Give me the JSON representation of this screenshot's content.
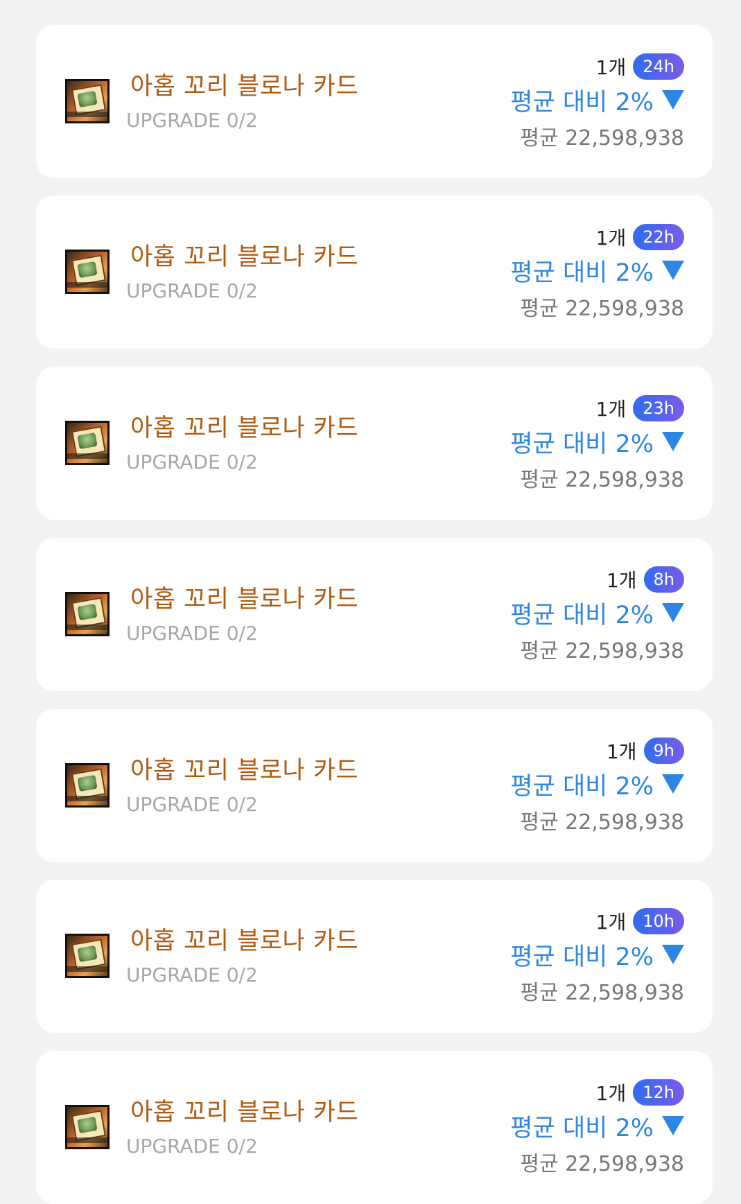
{
  "items": [
    {
      "name": "아홉 꼬리 블로나 카드",
      "upgrade": "UPGRADE 0/2",
      "quantity": "1개",
      "hours": "24h",
      "compare": "평균 대비 2%",
      "average": "평균 22,598,938"
    },
    {
      "name": "아홉 꼬리 블로나 카드",
      "upgrade": "UPGRADE 0/2",
      "quantity": "1개",
      "hours": "22h",
      "compare": "평균 대비 2%",
      "average": "평균 22,598,938"
    },
    {
      "name": "아홉 꼬리 블로나 카드",
      "upgrade": "UPGRADE 0/2",
      "quantity": "1개",
      "hours": "23h",
      "compare": "평균 대비 2%",
      "average": "평균 22,598,938"
    },
    {
      "name": "아홉 꼬리 블로나 카드",
      "upgrade": "UPGRADE 0/2",
      "quantity": "1개",
      "hours": "8h",
      "compare": "평균 대비 2%",
      "average": "평균 22,598,938"
    },
    {
      "name": "아홉 꼬리 블로나 카드",
      "upgrade": "UPGRADE 0/2",
      "quantity": "1개",
      "hours": "9h",
      "compare": "평균 대비 2%",
      "average": "평균 22,598,938"
    },
    {
      "name": "아홉 꼬리 블로나 카드",
      "upgrade": "UPGRADE 0/2",
      "quantity": "1개",
      "hours": "10h",
      "compare": "평균 대비 2%",
      "average": "평균 22,598,938"
    },
    {
      "name": "아홉 꼬리 블로나 카드",
      "upgrade": "UPGRADE 0/2",
      "quantity": "1개",
      "hours": "12h",
      "compare": "평균 대비 2%",
      "average": "평균 22,598,938"
    }
  ],
  "icons": {
    "item_thumbnail": "card-item-thumbnail",
    "trend": "triangle-down-icon"
  },
  "colors": {
    "item_name": "#b05a10",
    "compare": "#2d86e3",
    "badge_start": "#2f6df0",
    "badge_end": "#7b5be8"
  }
}
